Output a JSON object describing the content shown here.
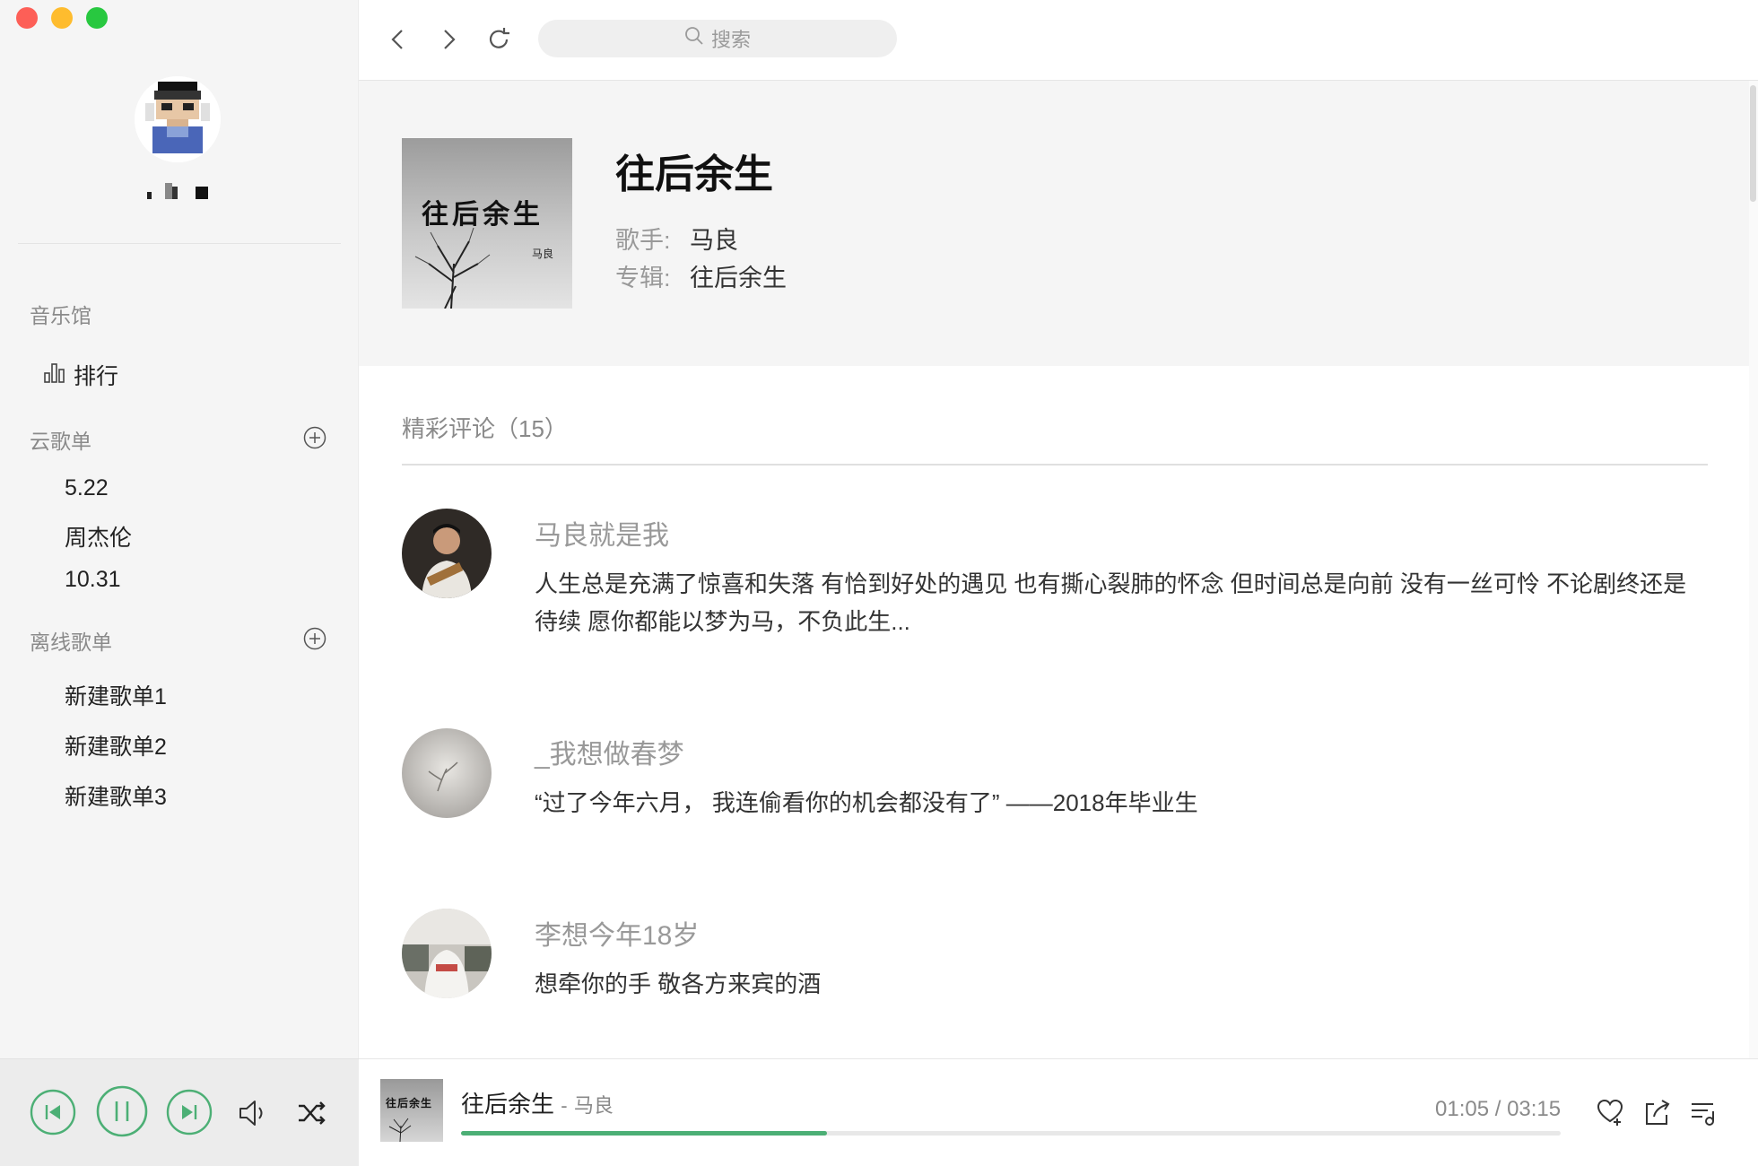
{
  "sidebar": {
    "music_hall_title": "音乐馆",
    "ranking_label": "排行",
    "cloud_playlists_title": "云歌单",
    "cloud_playlists": [
      "5.22",
      "周杰伦",
      "10.31"
    ],
    "offline_playlists_title": "离线歌单",
    "offline_playlists": [
      "新建歌单1",
      "新建歌单2",
      "新建歌单3"
    ]
  },
  "search": {
    "placeholder": "搜索"
  },
  "song": {
    "title": "往后余生",
    "artist_label": "歌手:",
    "artist": "马良",
    "album_label": "专辑:",
    "album": "往后余生",
    "cover_text": "往后余生",
    "cover_signature": "马良"
  },
  "comments": {
    "title": "精彩评论（15）",
    "items": [
      {
        "user": "马良就是我",
        "text": "人生总是充满了惊喜和失落 有恰到好处的遇见 也有撕心裂肺的怀念 但时间总是向前 没有一丝可怜 不论剧终还是待续 愿你都能以梦为马，不负此生..."
      },
      {
        "user": "_我想做春梦",
        "text": "“过了今年六月， 我连偷看你的机会都没有了” ——2018年毕业生"
      },
      {
        "user": "李想今年18岁",
        "text": "想牵你的手 敬各方来宾的酒"
      }
    ]
  },
  "player": {
    "title": "往后余生",
    "separator": "-",
    "artist": "马良",
    "time": "01:05 / 03:15",
    "progress": 0.333,
    "cover_text": "往后余生"
  },
  "colors": {
    "accent": "#4caf75",
    "sidebar_bg": "#f5f5f5",
    "header_bg": "#f5f5f5"
  }
}
